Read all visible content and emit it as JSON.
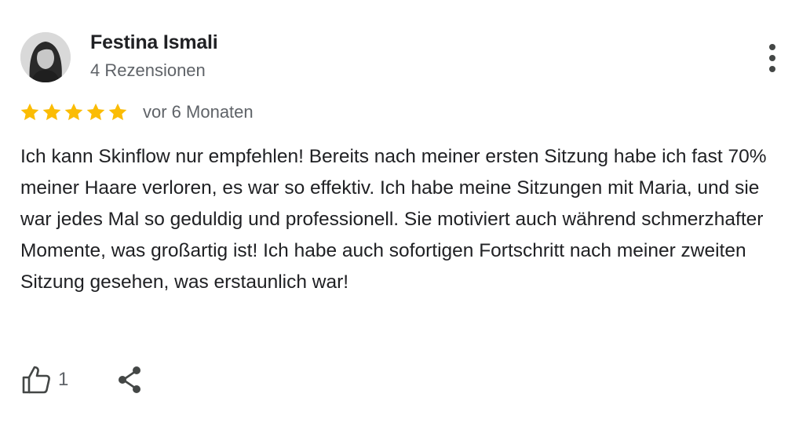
{
  "review": {
    "author_name": "Festina Ismali",
    "review_count": "4 Rezensionen",
    "rating": 5,
    "rating_max": 5,
    "date": "vor 6 Monaten",
    "text": "Ich kann Skinflow nur empfehlen! Bereits nach meiner ersten Sitzung habe ich fast 70% meiner Haare verloren, es war so effektiv. Ich habe meine Sitzungen mit Maria, und sie war jedes Mal so geduldig und professionell. Sie motiviert auch während schmerzhafter Momente, was großartig ist! Ich habe auch sofortigen Fortschritt nach meiner zweiten Sitzung gesehen, was erstaunlich war!",
    "likes": "1"
  },
  "icons": {
    "avatar": "avatar-photo",
    "more": "more-vert-icon",
    "star": "star-icon",
    "like": "thumb-up-icon",
    "share": "share-icon"
  },
  "colors": {
    "star": "#fbbc04",
    "text": "#202124",
    "secondary_text": "#5f6368",
    "icon": "#444746"
  }
}
